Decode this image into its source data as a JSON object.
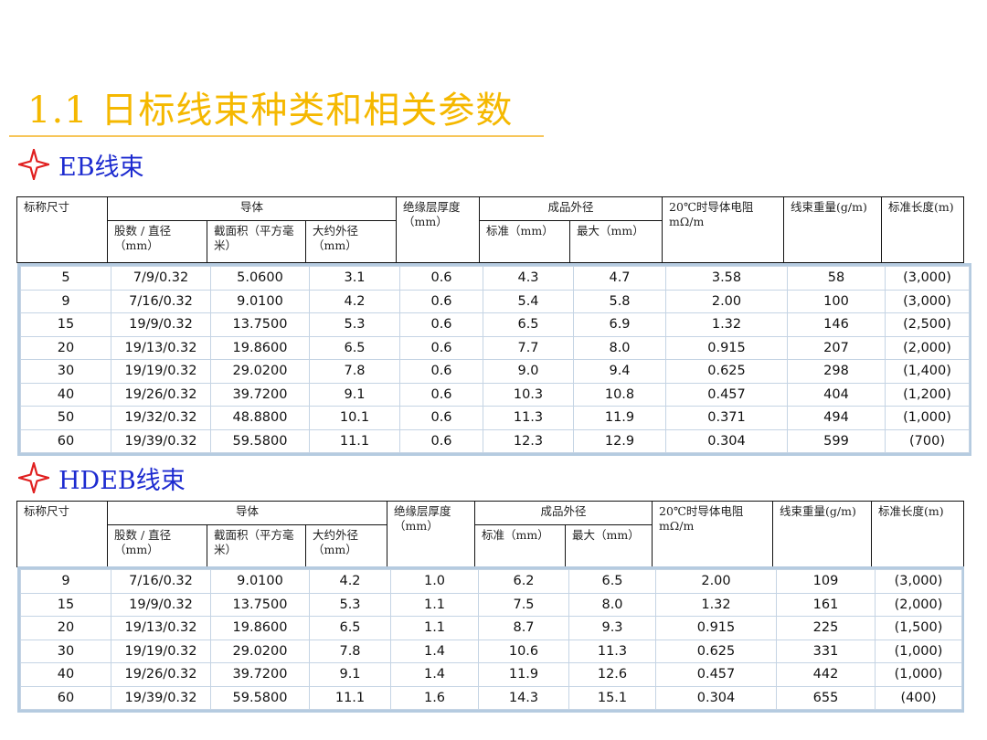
{
  "title": "1.1 日标线束种类和相关参数",
  "colors": {
    "title": "#f5b800",
    "section": "#1d2bd0",
    "star": "#e02020",
    "box_border": "#b5cbe0"
  },
  "eb": {
    "section_label": "EB线束",
    "headers": {
      "size": "标称尺寸",
      "conductor": "导体",
      "strands": "股数 / 直径（mm）",
      "area": "截面积（平方毫米）",
      "approx_od": "大约外径（mm）",
      "insulation": "绝缘层厚度（mm）",
      "finished_od": "成品外径",
      "std": "标准（mm）",
      "max": "最大（mm）",
      "resistance": "20℃时导体电阻 mΩ/m",
      "weight": "线束重量(g/m)",
      "length": "标准长度(m)"
    },
    "rows": [
      [
        "5",
        "7/9/0.32",
        "5.0600",
        "3.1",
        "0.6",
        "4.3",
        "4.7",
        "3.58",
        "58",
        "(3,000)"
      ],
      [
        "9",
        "7/16/0.32",
        "9.0100",
        "4.2",
        "0.6",
        "5.4",
        "5.8",
        "2.00",
        "100",
        "(3,000)"
      ],
      [
        "15",
        "19/9/0.32",
        "13.7500",
        "5.3",
        "0.6",
        "6.5",
        "6.9",
        "1.32",
        "146",
        "(2,500)"
      ],
      [
        "20",
        "19/13/0.32",
        "19.8600",
        "6.5",
        "0.6",
        "7.7",
        "8.0",
        "0.915",
        "207",
        "(2,000)"
      ],
      [
        "30",
        "19/19/0.32",
        "29.0200",
        "7.8",
        "0.6",
        "9.0",
        "9.4",
        "0.625",
        "298",
        "(1,400)"
      ],
      [
        "40",
        "19/26/0.32",
        "39.7200",
        "9.1",
        "0.6",
        "10.3",
        "10.8",
        "0.457",
        "404",
        "(1,200)"
      ],
      [
        "50",
        "19/32/0.32",
        "48.8800",
        "10.1",
        "0.6",
        "11.3",
        "11.9",
        "0.371",
        "494",
        "(1,000)"
      ],
      [
        "60",
        "19/39/0.32",
        "59.5800",
        "11.1",
        "0.6",
        "12.3",
        "12.9",
        "0.304",
        "599",
        "(700)"
      ]
    ]
  },
  "hdeb": {
    "section_label": "HDEB线束",
    "headers": {
      "size": "标称尺寸",
      "conductor": "导体",
      "strands": "股数 / 直径（mm）",
      "area": "截面积（平方毫米）",
      "approx_od": "大约外径（mm）",
      "insulation": "绝缘层厚度（mm）",
      "finished_od": "成品外径",
      "std": "标准（mm）",
      "max": "最大（mm）",
      "resistance": "20℃时导体电阻 mΩ/m",
      "weight": "线束重量(g/m)",
      "length": "标准长度(m)"
    },
    "rows": [
      [
        "9",
        "7/16/0.32",
        "9.0100",
        "4.2",
        "1.0",
        "6.2",
        "6.5",
        "2.00",
        "109",
        "(3,000)"
      ],
      [
        "15",
        "19/9/0.32",
        "13.7500",
        "5.3",
        "1.1",
        "7.5",
        "8.0",
        "1.32",
        "161",
        "(2,000)"
      ],
      [
        "20",
        "19/13/0.32",
        "19.8600",
        "6.5",
        "1.1",
        "8.7",
        "9.3",
        "0.915",
        "225",
        "(1,500)"
      ],
      [
        "30",
        "19/19/0.32",
        "29.0200",
        "7.8",
        "1.4",
        "10.6",
        "11.3",
        "0.625",
        "331",
        "(1,000)"
      ],
      [
        "40",
        "19/26/0.32",
        "39.7200",
        "9.1",
        "1.4",
        "11.9",
        "12.6",
        "0.457",
        "442",
        "(1,000)"
      ],
      [
        "60",
        "19/39/0.32",
        "59.5800",
        "11.1",
        "1.6",
        "14.3",
        "15.1",
        "0.304",
        "655",
        "(400)"
      ]
    ]
  }
}
